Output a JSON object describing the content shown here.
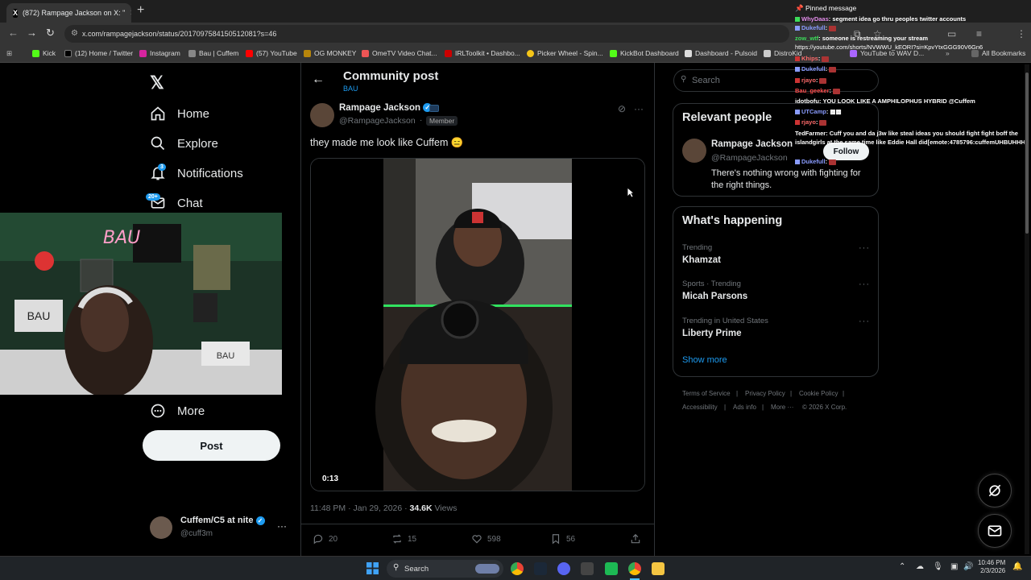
{
  "browser": {
    "tab_title": "(872) Rampage Jackson on X: \"",
    "url": "x.com/rampagejackson/status/2017097584150512081?s=46",
    "bookmarks": [
      "Kick",
      "(12) Home / Twitter",
      "Instagram",
      "Bau | Cuffem",
      "(57) YouTube",
      "OG MONKEY",
      "OmeTV Video Chat...",
      "IRLToolkit • Dashbo...",
      "Picker Wheel - Spin...",
      "KickBot Dashboard",
      "Dashboard - Pulsoid",
      "DistroKid",
      "YouTube to WAV D..."
    ],
    "all_bookmarks": "All Bookmarks"
  },
  "nav": {
    "home": "Home",
    "explore": "Explore",
    "notifications": "Notifications",
    "notifications_badge": "3",
    "chat": "Chat",
    "chat_badge": "20+",
    "more": "More",
    "post": "Post",
    "account_name": "Cuffem/C5 at nite",
    "account_handle": "@cuff3m"
  },
  "post": {
    "header_title": "Community post",
    "header_sub": "BAU",
    "author_name": "Rampage Jackson",
    "author_handle": "@RampageJackson",
    "member_label": "Member",
    "text": "they made me look like Cuffem 😑",
    "video_time": "0:13",
    "timestamp": "11:48 PM · Jan 29, 2026 · ",
    "views_count": "34.6K",
    "views_label": " Views",
    "replies": "20",
    "reposts": "15",
    "likes": "598",
    "bookmarks": "56"
  },
  "sidebar": {
    "search_placeholder": "Search",
    "relevant_title": "Relevant people",
    "rel_name": "Rampage Jackson",
    "rel_handle": "@RampageJackson",
    "rel_bio": "There's nothing wrong with fighting for the right things.",
    "follow": "Follow",
    "happening_title": "What's happening",
    "trends": [
      {
        "cat": "Trending",
        "name": "Khamzat"
      },
      {
        "cat": "Sports · Trending",
        "name": "Micah Parsons"
      },
      {
        "cat": "Trending in United States",
        "name": "Liberty Prime"
      }
    ],
    "show_more": "Show more",
    "footer": [
      "Terms of Service",
      "|",
      "Privacy Policy",
      "|",
      "Cookie Policy",
      "|",
      "Accessibility",
      "|",
      "Ads info",
      "|",
      "More ···",
      "© 2026 X Corp."
    ]
  },
  "chat": {
    "pinned": "Pinned message",
    "messages": [
      {
        "user": "WhyDaas",
        "color": "#e08be8",
        "text": ": segment idea go thru peoples twitter accounts"
      },
      {
        "user": "Dukefull",
        "color": "#8a9cff",
        "text": ":"
      },
      {
        "user": "zow_wtf",
        "color": "#3ddc5a",
        "text": ": someone is restreaming your stream"
      },
      {
        "user": "",
        "color": "#fff",
        "text": "https://youtube.com/shorts/NVWWU_kEORI?si=KpvYtxGGG90V6Gn6"
      },
      {
        "user": "Khips",
        "color": "#ff6b6b",
        "text": ":"
      },
      {
        "user": "Dukefull",
        "color": "#8a9cff",
        "text": ":"
      },
      {
        "user": "rjayo",
        "color": "#ff6b6b",
        "text": ":"
      },
      {
        "user": "Bau_geeker",
        "color": "#ff4d4d",
        "text": ":"
      },
      {
        "user": "idotbofu",
        "color": "#ffffff",
        "text": ": YOU LOOK LIKE A AMPHILOPHUS HYBRID @Cuffem"
      },
      {
        "user": "UTCamp",
        "color": "#8a9cff",
        "text": ":"
      },
      {
        "user": "rjayo",
        "color": "#ff6b6b",
        "text": ":"
      },
      {
        "user": "TedFarmer",
        "color": "#ffffff",
        "text": ": Cuff you and da j3w like steal ideas you should fight fight boff the"
      },
      {
        "user": "",
        "color": "#fff",
        "text": "islandgirls at the same time like Eddie Hall did[emote:4785796:cuffemUHBUHHH"
      },
      {
        "user": "Dukefull",
        "color": "#8a9cff",
        "text": ":"
      }
    ]
  },
  "taskbar": {
    "search": "Search",
    "time": "10:46 PM",
    "date": "2/3/2026"
  }
}
